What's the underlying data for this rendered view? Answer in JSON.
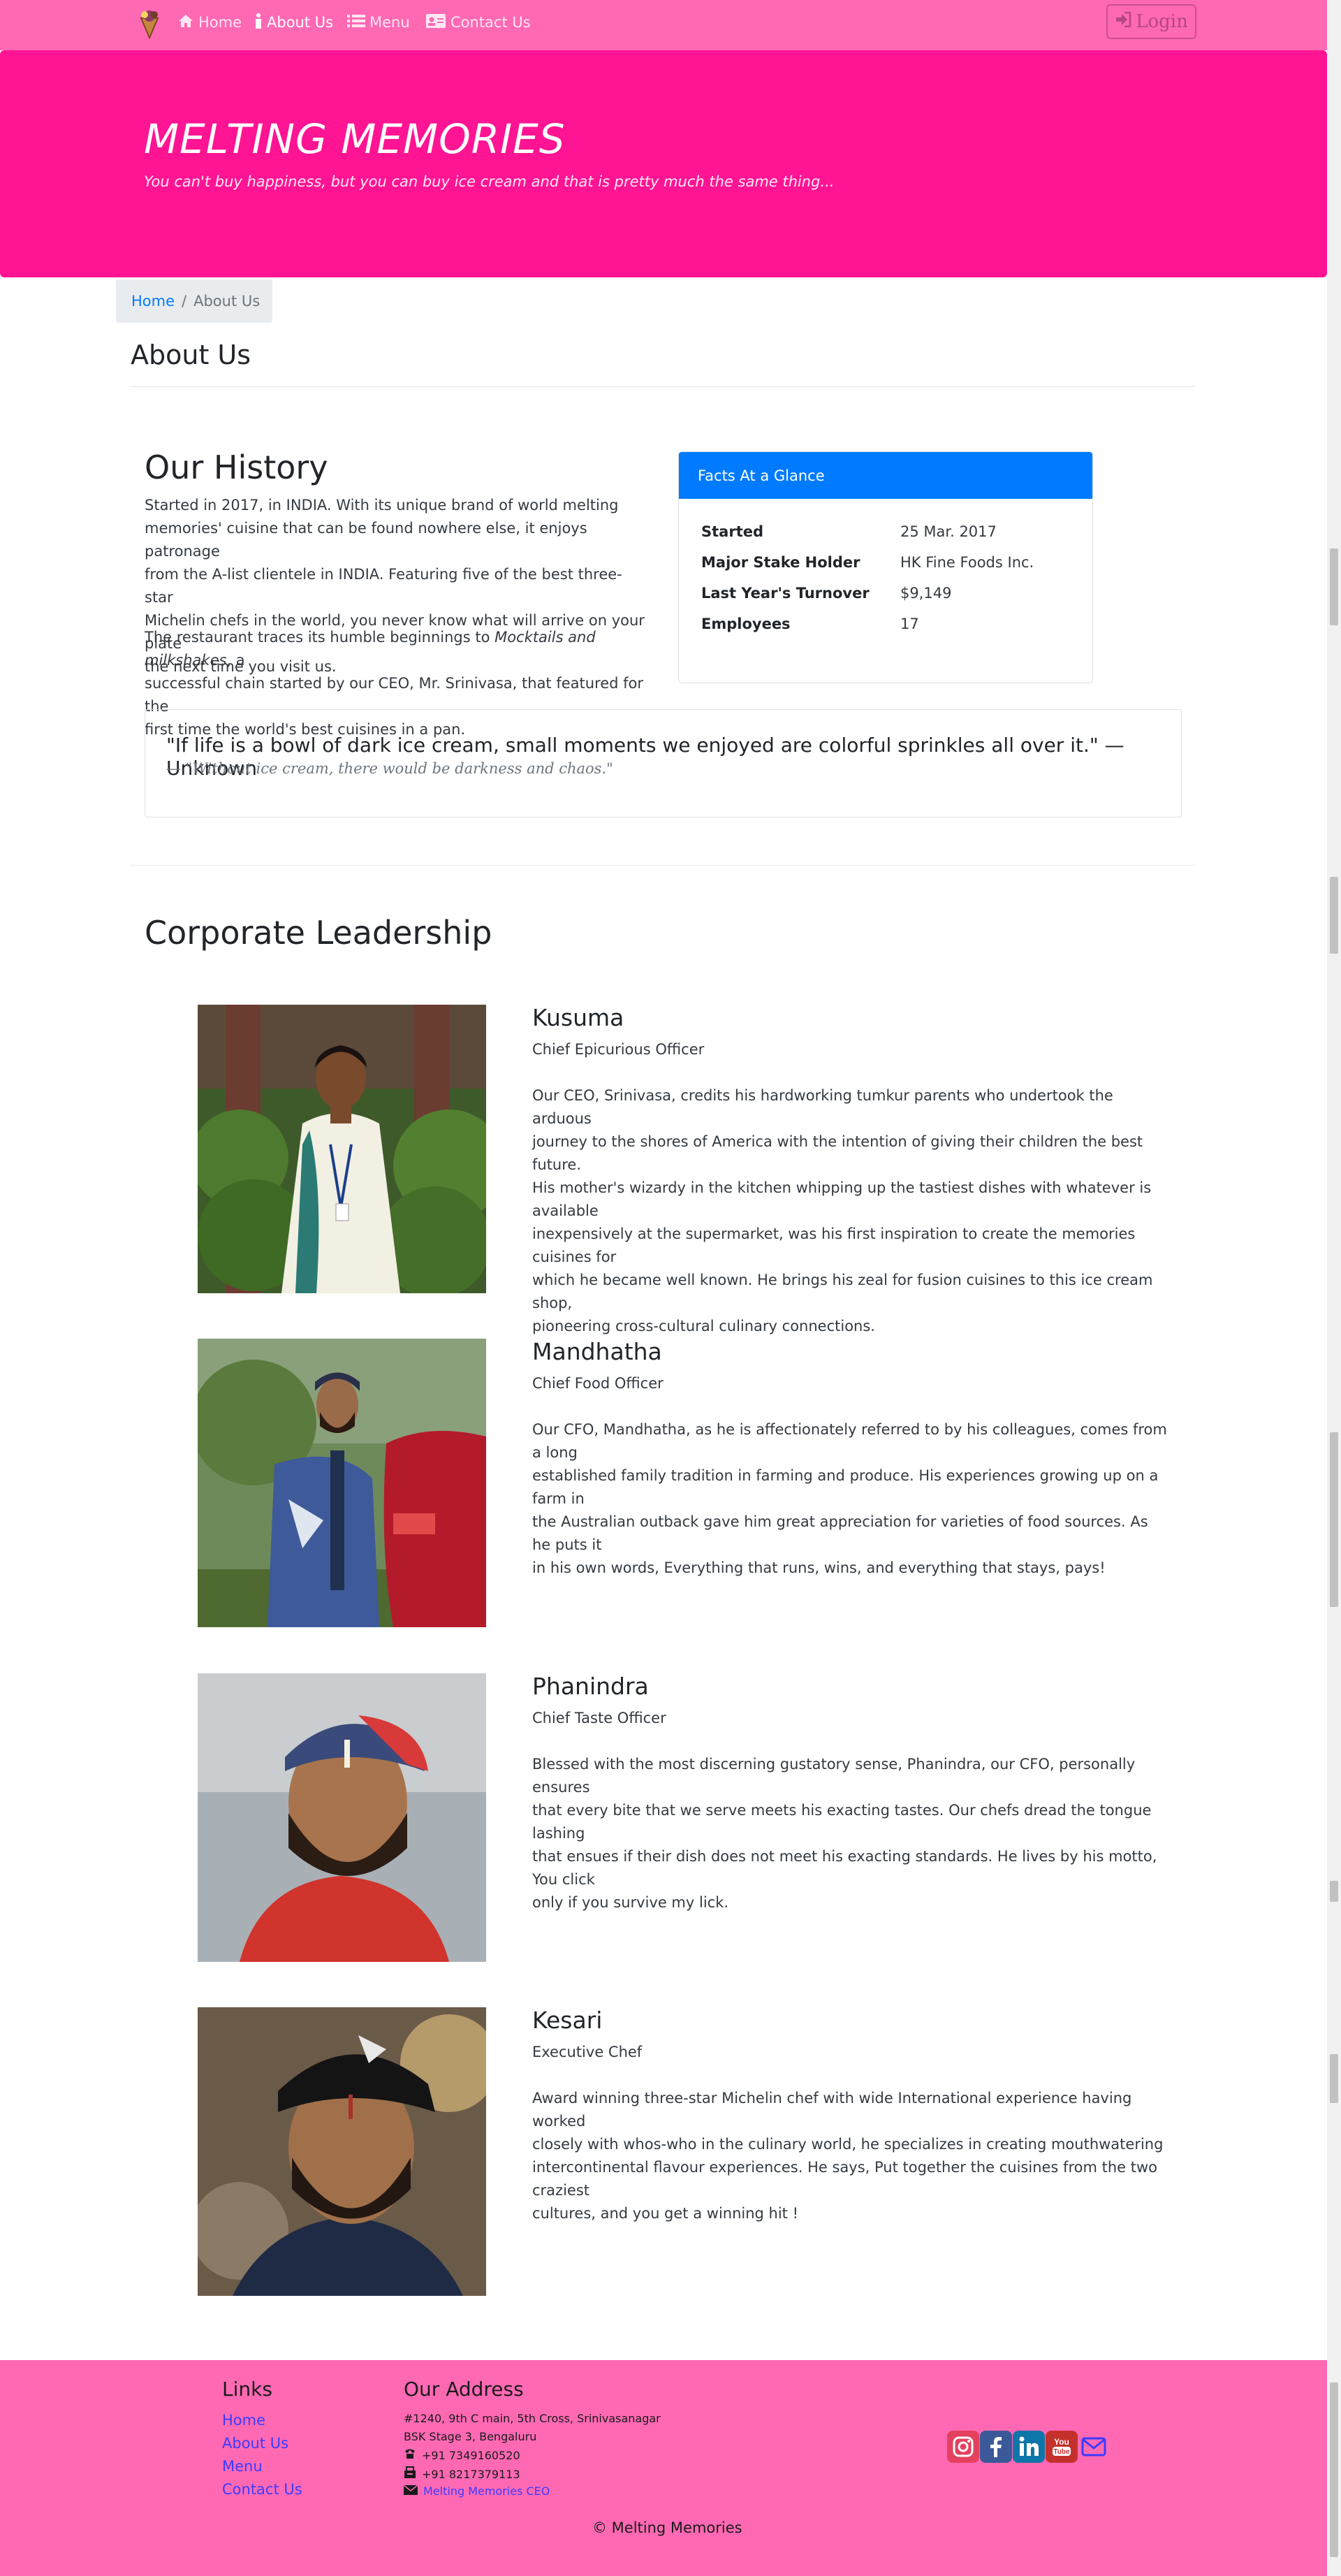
{
  "navbar": {
    "items": [
      {
        "label": "Home",
        "icon": "home-icon"
      },
      {
        "label": "About Us",
        "icon": "info-icon"
      },
      {
        "label": "Menu",
        "icon": "list-icon"
      },
      {
        "label": "Contact Us",
        "icon": "address-card-icon"
      }
    ],
    "login_label": "Login"
  },
  "jumbotron": {
    "title": "MELTING MEMORIES",
    "subtitle": "You can't buy happiness, but you can buy ice cream and that is pretty much the same thing..."
  },
  "breadcrumb": {
    "home": "Home",
    "sep": "/",
    "current": "About Us"
  },
  "page_title": "About Us",
  "history": {
    "heading": "Our History",
    "para1_lines": [
      "Started in 2017, in INDIA. With its unique brand of world melting",
      "memories' cuisine that can be found nowhere else, it enjoys patronage",
      "from the A-list clientele in INDIA. Featuring five of the best three-star",
      "Michelin chefs in the world, you never know what will arrive on your plate",
      "the next time you visit us."
    ],
    "para2_a": "The restaurant traces its humble beginnings to ",
    "para2_em": "Mocktails and milkshakes",
    "para2_b": ", a",
    "para2_lines": [
      "successful chain started by our CEO, Mr. Srinivasa, that featured for the",
      "first time the world's best cuisines in a pan."
    ]
  },
  "facts": {
    "header": "Facts At a Glance",
    "rows": [
      {
        "label": "Started",
        "value": "25 Mar. 2017"
      },
      {
        "label": "Major Stake Holder",
        "value": "HK Fine Foods Inc."
      },
      {
        "label": "Last Year's Turnover",
        "value": "$9,149"
      },
      {
        "label": "Employees",
        "value": "17"
      }
    ]
  },
  "quote": {
    "text": "\"If life is a bowl of dark ice cream, small moments we enjoyed are colorful sprinkles all over it.\" — Unknown",
    "source": "— \"Without ice cream, there would be darkness and chaos.\""
  },
  "leadership": {
    "heading": "Corporate Leadership",
    "leaders": [
      {
        "name": "Kusuma",
        "role": "Chief Epicurious Officer",
        "bio_lines": [
          "Our CEO, Srinivasa, credits his hardworking tumkur parents who undertook the arduous",
          "journey to the shores of America with the intention of giving their children the best future.",
          "His mother's wizardy in the kitchen whipping up the tastiest dishes with whatever is available",
          "inexpensively at the supermarket, was his first inspiration to create the memories cuisines for",
          "which he became well known. He brings his zeal for fusion cuisines to this ice cream shop,",
          "pioneering cross-cultural culinary connections."
        ]
      },
      {
        "name": "Mandhatha",
        "role": "Chief Food Officer",
        "bio_lines": [
          "Our CFO, Mandhatha, as he is affectionately referred to by his colleagues, comes from a long",
          "established family tradition in farming and produce. His experiences growing up on a farm in",
          "the Australian outback gave him great appreciation for varieties of food sources. As he puts it",
          "in his own words, Everything that runs, wins, and everything that stays, pays!"
        ]
      },
      {
        "name": "Phanindra",
        "role": "Chief Taste Officer",
        "bio_lines": [
          "Blessed with the most discerning gustatory sense, Phanindra, our CFO, personally ensures",
          "that every bite that we serve meets his exacting tastes. Our chefs dread the tongue lashing",
          "that ensues if their dish does not meet his exacting standards. He lives by his motto, You click",
          "only if you survive my lick."
        ]
      },
      {
        "name": "Kesari",
        "role": "Executive Chef",
        "bio_lines": [
          "Award winning three-star Michelin chef with wide International experience having worked",
          "closely with whos-who in the culinary world, he specializes in creating mouthwatering",
          "intercontinental flavour experiences. He says, Put together the cuisines from the two craziest",
          "cultures, and you get a winning hit !"
        ]
      }
    ]
  },
  "footer": {
    "links_heading": "Links",
    "links": [
      "Home",
      "About Us",
      "Menu",
      "Contact Us"
    ],
    "address_heading": "Our Address",
    "address_line1": "#1240, 9th C main, 5th Cross, Srinivasanagar",
    "address_line2": "BSK Stage 3, Bengaluru",
    "phone": "+91 7349160520",
    "fax": "+91 8217379113",
    "email": "Melting Memories CEO",
    "copyright": "© Melting Memories"
  },
  "colors": {
    "navbar": "#ff69b4",
    "jumbotron": "#ff1493",
    "card_header": "#007bff",
    "footer": "#ff69b4"
  }
}
